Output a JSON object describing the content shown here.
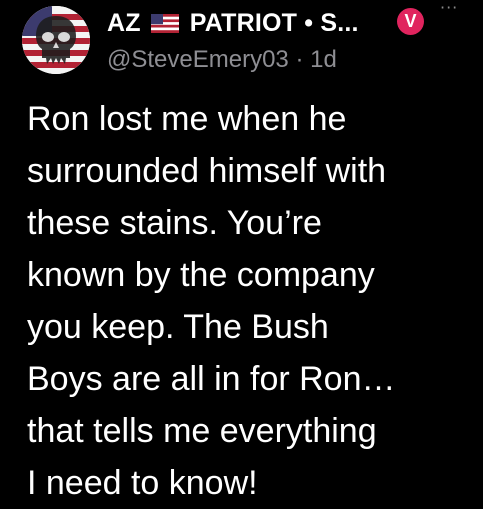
{
  "tweet": {
    "author": {
      "name_start": "AZ",
      "flag_icon": "us-flag-icon",
      "name_end": "PATRIOT • S...",
      "badge": "V",
      "badge_color": "#e0245e",
      "handle": "@SteveEmery03",
      "separator": "·",
      "time": "1d"
    },
    "more_label": "···",
    "text_lines": [
      "Ron lost me when he",
      "surrounded himself with",
      "these stains. You’re",
      "known by the company",
      "you keep. The Bush",
      "Boys are all in for Ron…",
      "that tells me everything",
      "I need to know!"
    ]
  }
}
